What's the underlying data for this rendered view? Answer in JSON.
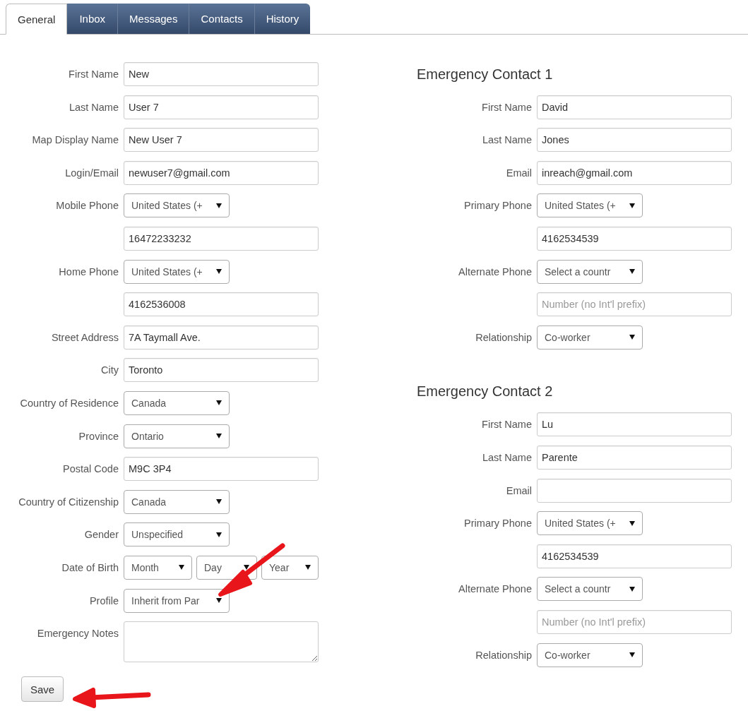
{
  "tabs": [
    {
      "label": "General",
      "selected": true
    },
    {
      "label": "Inbox",
      "selected": false
    },
    {
      "label": "Messages",
      "selected": false
    },
    {
      "label": "Contacts",
      "selected": false
    },
    {
      "label": "History",
      "selected": false
    }
  ],
  "profile_form": {
    "rows": [
      {
        "label": "First Name",
        "controls": [
          {
            "kind": "text",
            "value": "New"
          }
        ]
      },
      {
        "label": "Last Name",
        "controls": [
          {
            "kind": "text",
            "value": "User 7"
          }
        ]
      },
      {
        "label": "Map Display Name",
        "controls": [
          {
            "kind": "text",
            "value": "New User 7"
          }
        ]
      },
      {
        "label": "Login/Email",
        "controls": [
          {
            "kind": "text",
            "value": "newuser7@gmail.com"
          }
        ]
      },
      {
        "label": "Mobile Phone",
        "controls": [
          {
            "kind": "select",
            "value": "United States (+"
          }
        ]
      },
      {
        "controls": [
          {
            "kind": "text",
            "value": "16472233232"
          }
        ]
      },
      {
        "label": "Home Phone",
        "controls": [
          {
            "kind": "select",
            "value": "United States (+"
          }
        ]
      },
      {
        "controls": [
          {
            "kind": "text",
            "value": "4162536008"
          }
        ]
      },
      {
        "label": "Street Address",
        "controls": [
          {
            "kind": "text",
            "value": "7A Taymall Ave."
          }
        ]
      },
      {
        "label": "City",
        "controls": [
          {
            "kind": "text",
            "value": "Toronto"
          }
        ]
      },
      {
        "label": "Country of Residence",
        "controls": [
          {
            "kind": "select",
            "value": "Canada"
          }
        ]
      },
      {
        "label": "Province",
        "controls": [
          {
            "kind": "select",
            "value": "Ontario"
          }
        ]
      },
      {
        "label": "Postal Code",
        "controls": [
          {
            "kind": "text",
            "value": "M9C 3P4"
          }
        ]
      },
      {
        "label": "Country of Citizenship",
        "controls": [
          {
            "kind": "select",
            "value": "Canada"
          }
        ]
      },
      {
        "label": "Gender",
        "controls": [
          {
            "kind": "select",
            "value": "Unspecified"
          }
        ]
      },
      {
        "label": "Date of Birth",
        "controls": [
          {
            "kind": "month",
            "value": "Month"
          },
          {
            "kind": "day",
            "value": "Day"
          },
          {
            "kind": "year",
            "value": "Year"
          }
        ]
      },
      {
        "label": "Profile",
        "controls": [
          {
            "kind": "select",
            "value": "Inherit from Par"
          }
        ]
      },
      {
        "label": "Emergency Notes",
        "controls": [
          {
            "kind": "textarea"
          }
        ]
      }
    ]
  },
  "save_button": "Save",
  "emergency_contacts": [
    {
      "title": "Emergency Contact 1",
      "rows": [
        {
          "label": "First Name",
          "controls": [
            {
              "kind": "text",
              "value": "David"
            }
          ]
        },
        {
          "label": "Last Name",
          "controls": [
            {
              "kind": "text",
              "value": "Jones"
            }
          ]
        },
        {
          "label": "Email",
          "controls": [
            {
              "kind": "text",
              "value": "inreach@gmail.com"
            }
          ]
        },
        {
          "label": "Primary Phone",
          "controls": [
            {
              "kind": "select",
              "value": "United States (+"
            }
          ]
        },
        {
          "controls": [
            {
              "kind": "text",
              "value": "4162534539"
            }
          ]
        },
        {
          "label": "Alternate Phone",
          "controls": [
            {
              "kind": "select",
              "value": "Select a countr"
            }
          ]
        },
        {
          "controls": [
            {
              "kind": "text",
              "placeholder": "Number (no Int'l prefix)"
            }
          ]
        },
        {
          "label": "Relationship",
          "controls": [
            {
              "kind": "select",
              "value": "Co-worker"
            }
          ]
        }
      ]
    },
    {
      "title": "Emergency Contact 2",
      "rows": [
        {
          "label": "First Name",
          "controls": [
            {
              "kind": "text",
              "value": "Lu"
            }
          ]
        },
        {
          "label": "Last Name",
          "controls": [
            {
              "kind": "text",
              "value": "Parente"
            }
          ]
        },
        {
          "label": "Email",
          "controls": [
            {
              "kind": "text"
            }
          ]
        },
        {
          "label": "Primary Phone",
          "controls": [
            {
              "kind": "select",
              "value": "United States (+"
            }
          ]
        },
        {
          "controls": [
            {
              "kind": "text",
              "value": "4162534539"
            }
          ]
        },
        {
          "label": "Alternate Phone",
          "controls": [
            {
              "kind": "select",
              "value": "Select a countr"
            }
          ]
        },
        {
          "controls": [
            {
              "kind": "text",
              "placeholder": "Number (no Int'l prefix)"
            }
          ]
        },
        {
          "label": "Relationship",
          "controls": [
            {
              "kind": "select",
              "value": "Co-worker"
            }
          ]
        }
      ]
    }
  ]
}
